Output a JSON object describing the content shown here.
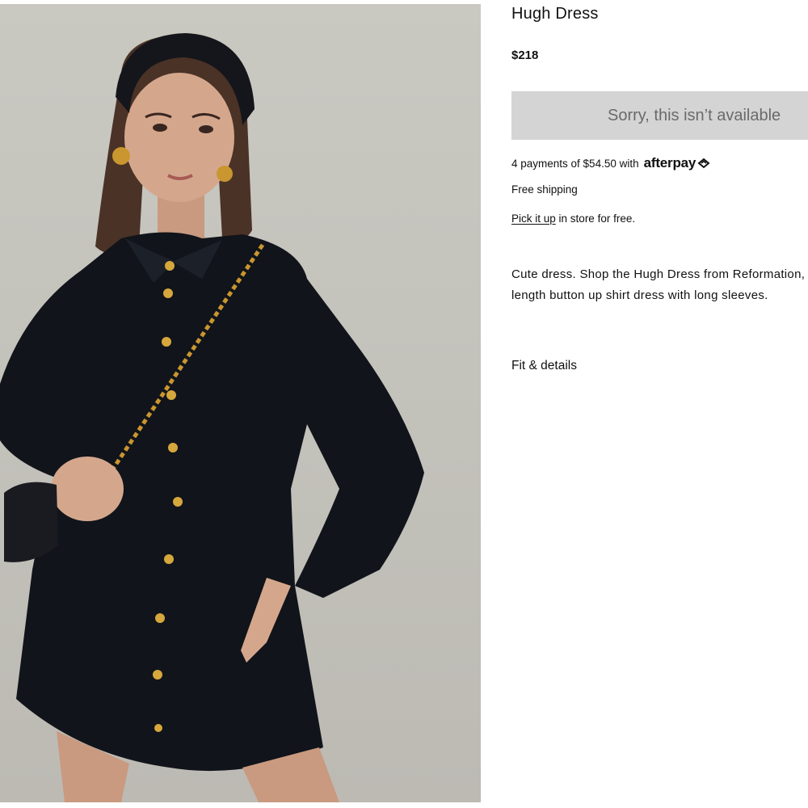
{
  "product": {
    "title": "Hugh Dress",
    "price": "$218",
    "image_alt": "Model wearing a black button-up mini shirt dress with gold buttons, black headband, and quilted chain bag",
    "unavailable_label": "Sorry, this isn’t available",
    "afterpay": {
      "text": "4 payments of $54.50 with",
      "brand": "afterpay",
      "logo_icon": "afterpay-loop-icon"
    },
    "shipping": "Free shipping",
    "pickup": {
      "link_text": "Pick it up",
      "rest": "in store for free."
    },
    "description": "Cute dress. Shop the Hugh Dress from Reformation, a mini length button up shirt dress with long sleeves.",
    "fit_details_label": "Fit & details"
  },
  "colors": {
    "photo_background": "#c6c5be",
    "dress": "#11141a",
    "buttons": "#d6a73c",
    "unavailable_bg": "#d4d4d4",
    "unavailable_text": "#6a6a6a"
  }
}
